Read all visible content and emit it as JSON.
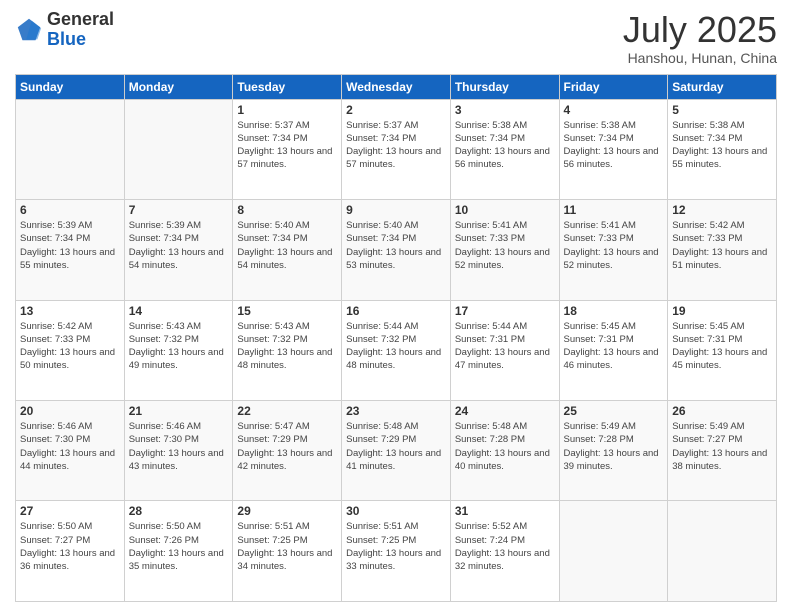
{
  "header": {
    "logo_general": "General",
    "logo_blue": "Blue",
    "month": "July 2025",
    "location": "Hanshou, Hunan, China"
  },
  "days_of_week": [
    "Sunday",
    "Monday",
    "Tuesday",
    "Wednesday",
    "Thursday",
    "Friday",
    "Saturday"
  ],
  "weeks": [
    [
      {
        "day": "",
        "sunrise": "",
        "sunset": "",
        "daylight": "",
        "empty": true
      },
      {
        "day": "",
        "sunrise": "",
        "sunset": "",
        "daylight": "",
        "empty": true
      },
      {
        "day": "1",
        "sunrise": "Sunrise: 5:37 AM",
        "sunset": "Sunset: 7:34 PM",
        "daylight": "Daylight: 13 hours and 57 minutes."
      },
      {
        "day": "2",
        "sunrise": "Sunrise: 5:37 AM",
        "sunset": "Sunset: 7:34 PM",
        "daylight": "Daylight: 13 hours and 57 minutes."
      },
      {
        "day": "3",
        "sunrise": "Sunrise: 5:38 AM",
        "sunset": "Sunset: 7:34 PM",
        "daylight": "Daylight: 13 hours and 56 minutes."
      },
      {
        "day": "4",
        "sunrise": "Sunrise: 5:38 AM",
        "sunset": "Sunset: 7:34 PM",
        "daylight": "Daylight: 13 hours and 56 minutes."
      },
      {
        "day": "5",
        "sunrise": "Sunrise: 5:38 AM",
        "sunset": "Sunset: 7:34 PM",
        "daylight": "Daylight: 13 hours and 55 minutes."
      }
    ],
    [
      {
        "day": "6",
        "sunrise": "Sunrise: 5:39 AM",
        "sunset": "Sunset: 7:34 PM",
        "daylight": "Daylight: 13 hours and 55 minutes."
      },
      {
        "day": "7",
        "sunrise": "Sunrise: 5:39 AM",
        "sunset": "Sunset: 7:34 PM",
        "daylight": "Daylight: 13 hours and 54 minutes."
      },
      {
        "day": "8",
        "sunrise": "Sunrise: 5:40 AM",
        "sunset": "Sunset: 7:34 PM",
        "daylight": "Daylight: 13 hours and 54 minutes."
      },
      {
        "day": "9",
        "sunrise": "Sunrise: 5:40 AM",
        "sunset": "Sunset: 7:34 PM",
        "daylight": "Daylight: 13 hours and 53 minutes."
      },
      {
        "day": "10",
        "sunrise": "Sunrise: 5:41 AM",
        "sunset": "Sunset: 7:33 PM",
        "daylight": "Daylight: 13 hours and 52 minutes."
      },
      {
        "day": "11",
        "sunrise": "Sunrise: 5:41 AM",
        "sunset": "Sunset: 7:33 PM",
        "daylight": "Daylight: 13 hours and 52 minutes."
      },
      {
        "day": "12",
        "sunrise": "Sunrise: 5:42 AM",
        "sunset": "Sunset: 7:33 PM",
        "daylight": "Daylight: 13 hours and 51 minutes."
      }
    ],
    [
      {
        "day": "13",
        "sunrise": "Sunrise: 5:42 AM",
        "sunset": "Sunset: 7:33 PM",
        "daylight": "Daylight: 13 hours and 50 minutes."
      },
      {
        "day": "14",
        "sunrise": "Sunrise: 5:43 AM",
        "sunset": "Sunset: 7:32 PM",
        "daylight": "Daylight: 13 hours and 49 minutes."
      },
      {
        "day": "15",
        "sunrise": "Sunrise: 5:43 AM",
        "sunset": "Sunset: 7:32 PM",
        "daylight": "Daylight: 13 hours and 48 minutes."
      },
      {
        "day": "16",
        "sunrise": "Sunrise: 5:44 AM",
        "sunset": "Sunset: 7:32 PM",
        "daylight": "Daylight: 13 hours and 48 minutes."
      },
      {
        "day": "17",
        "sunrise": "Sunrise: 5:44 AM",
        "sunset": "Sunset: 7:31 PM",
        "daylight": "Daylight: 13 hours and 47 minutes."
      },
      {
        "day": "18",
        "sunrise": "Sunrise: 5:45 AM",
        "sunset": "Sunset: 7:31 PM",
        "daylight": "Daylight: 13 hours and 46 minutes."
      },
      {
        "day": "19",
        "sunrise": "Sunrise: 5:45 AM",
        "sunset": "Sunset: 7:31 PM",
        "daylight": "Daylight: 13 hours and 45 minutes."
      }
    ],
    [
      {
        "day": "20",
        "sunrise": "Sunrise: 5:46 AM",
        "sunset": "Sunset: 7:30 PM",
        "daylight": "Daylight: 13 hours and 44 minutes."
      },
      {
        "day": "21",
        "sunrise": "Sunrise: 5:46 AM",
        "sunset": "Sunset: 7:30 PM",
        "daylight": "Daylight: 13 hours and 43 minutes."
      },
      {
        "day": "22",
        "sunrise": "Sunrise: 5:47 AM",
        "sunset": "Sunset: 7:29 PM",
        "daylight": "Daylight: 13 hours and 42 minutes."
      },
      {
        "day": "23",
        "sunrise": "Sunrise: 5:48 AM",
        "sunset": "Sunset: 7:29 PM",
        "daylight": "Daylight: 13 hours and 41 minutes."
      },
      {
        "day": "24",
        "sunrise": "Sunrise: 5:48 AM",
        "sunset": "Sunset: 7:28 PM",
        "daylight": "Daylight: 13 hours and 40 minutes."
      },
      {
        "day": "25",
        "sunrise": "Sunrise: 5:49 AM",
        "sunset": "Sunset: 7:28 PM",
        "daylight": "Daylight: 13 hours and 39 minutes."
      },
      {
        "day": "26",
        "sunrise": "Sunrise: 5:49 AM",
        "sunset": "Sunset: 7:27 PM",
        "daylight": "Daylight: 13 hours and 38 minutes."
      }
    ],
    [
      {
        "day": "27",
        "sunrise": "Sunrise: 5:50 AM",
        "sunset": "Sunset: 7:27 PM",
        "daylight": "Daylight: 13 hours and 36 minutes."
      },
      {
        "day": "28",
        "sunrise": "Sunrise: 5:50 AM",
        "sunset": "Sunset: 7:26 PM",
        "daylight": "Daylight: 13 hours and 35 minutes."
      },
      {
        "day": "29",
        "sunrise": "Sunrise: 5:51 AM",
        "sunset": "Sunset: 7:25 PM",
        "daylight": "Daylight: 13 hours and 34 minutes."
      },
      {
        "day": "30",
        "sunrise": "Sunrise: 5:51 AM",
        "sunset": "Sunset: 7:25 PM",
        "daylight": "Daylight: 13 hours and 33 minutes."
      },
      {
        "day": "31",
        "sunrise": "Sunrise: 5:52 AM",
        "sunset": "Sunset: 7:24 PM",
        "daylight": "Daylight: 13 hours and 32 minutes."
      },
      {
        "day": "",
        "sunrise": "",
        "sunset": "",
        "daylight": "",
        "empty": true
      },
      {
        "day": "",
        "sunrise": "",
        "sunset": "",
        "daylight": "",
        "empty": true
      }
    ]
  ]
}
